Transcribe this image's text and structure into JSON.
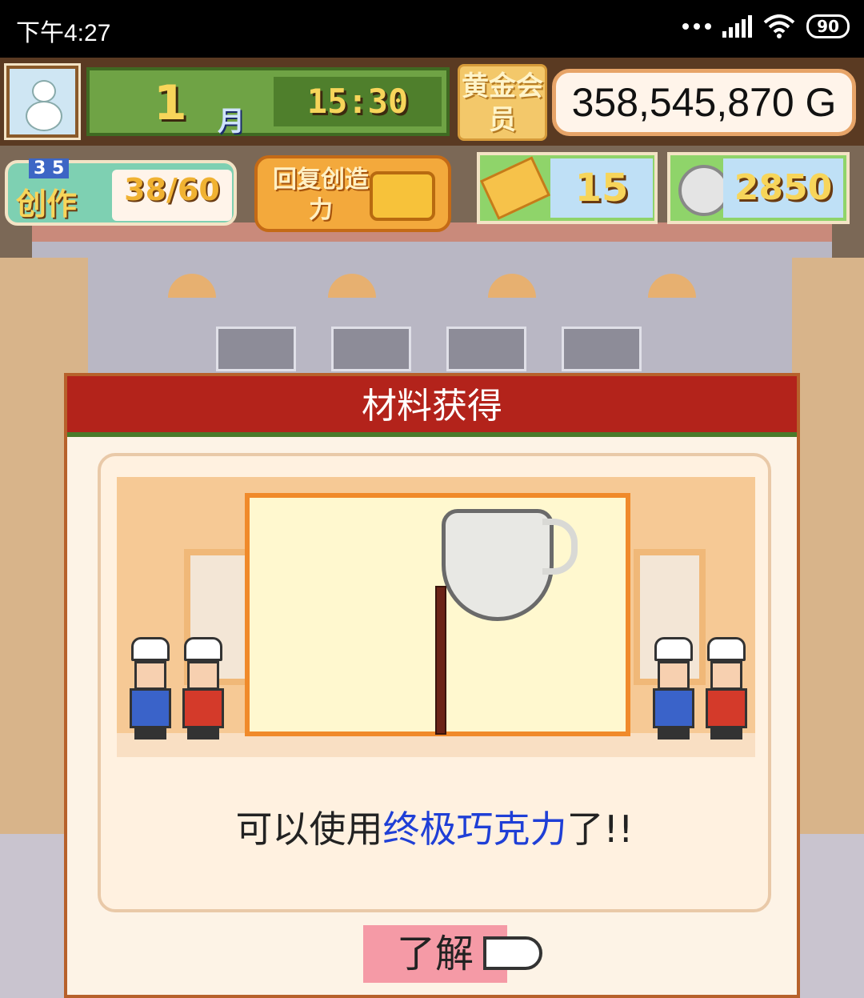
{
  "status_bar": {
    "time": "下午4:27",
    "battery": "90"
  },
  "hud": {
    "month_number": "1",
    "month_label": "月",
    "clock": "15:30",
    "gold_member_label": "黄金会员",
    "money": "358,545,870 G"
  },
  "resources": {
    "create_small": "3 5",
    "create_label": "创作",
    "create_count": "38/60",
    "restore_label": "回复创造力",
    "tickets": "15",
    "coins": "2850"
  },
  "dialog": {
    "title": "材料获得",
    "message_prefix": "可以使用",
    "message_highlight": "终极巧克力",
    "message_suffix": "了!!",
    "ok_label": "了解"
  },
  "colors": {
    "header_red": "#b3231b",
    "highlight_blue": "#1f3fd6",
    "ok_button_pink": "#f59aa6"
  }
}
